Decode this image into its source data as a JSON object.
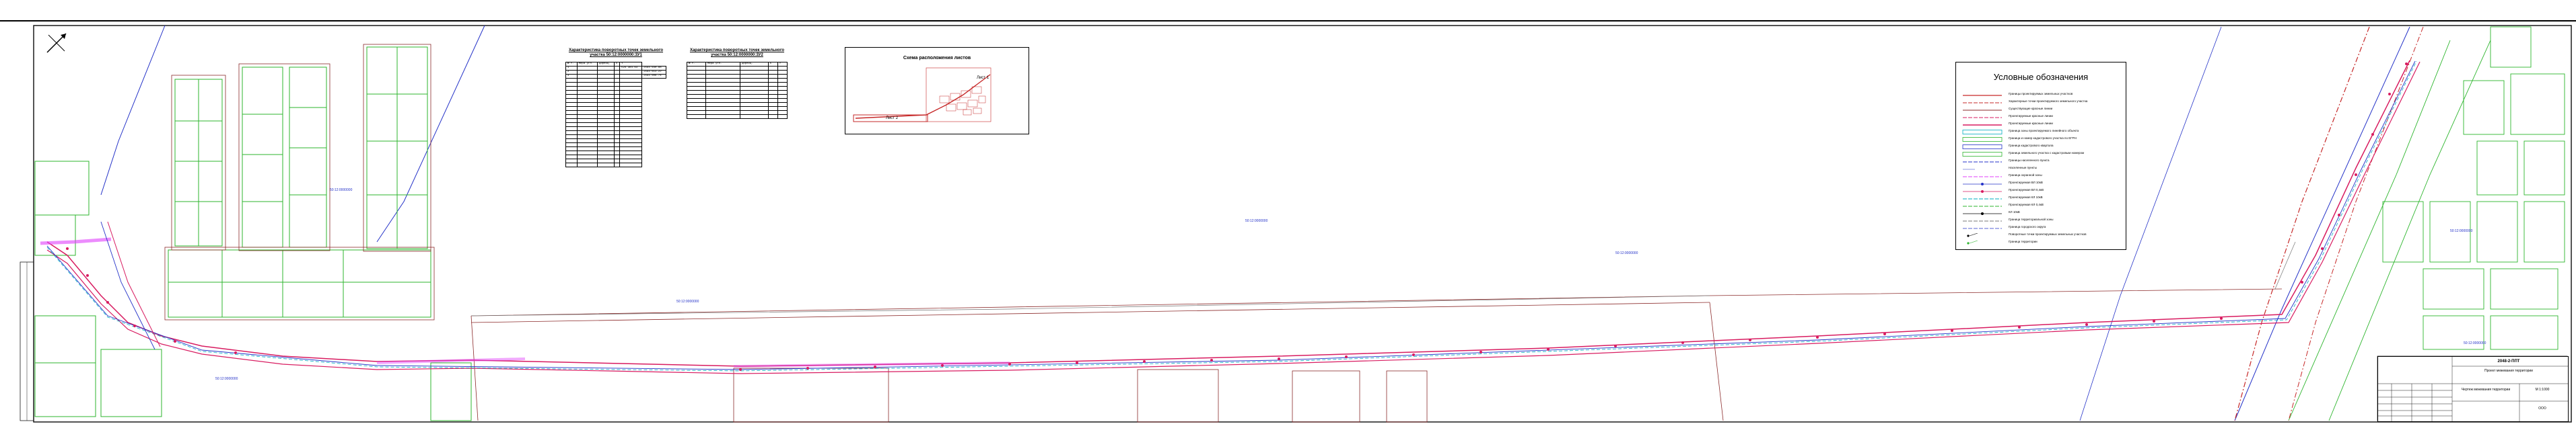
{
  "colors": {
    "border": "#1a1a1a",
    "parcel": "#2db52d",
    "plan_red": "#d81b60",
    "road_red": "#c62828",
    "blue": "#2432c8",
    "pink": "#e040fb",
    "cyan": "#00acc1",
    "gray": "#777777"
  },
  "icons": {
    "north": "north-arrow-icon"
  },
  "table1": {
    "title": "Характеристика поворотных точек земельного участка 50:12:0000000:ЗУ1",
    "rows": [
      [
        "№ т.",
        "Мера угл.",
        "Дирекц.",
        "X",
        "Y"
      ],
      [
        "1",
        "",
        "",
        "",
        "524 384.63",
        "2193 640.88"
      ],
      [
        "2",
        "",
        "",
        "",
        "",
        "2193 613.22"
      ],
      [
        "3",
        "",
        "",
        "",
        "",
        "2193 608.74"
      ]
    ]
  },
  "table2": {
    "title": "Характеристика поворотных точек земельного участка 50:12:0000000:ЗУ2",
    "rows": [
      [
        "№ т.",
        "Мера угл.",
        "Дирекц.",
        "X",
        "Y"
      ]
    ]
  },
  "schema": {
    "title": "Схема расположения листов",
    "sheet1": "Лист 1",
    "sheet2": "Лист 2"
  },
  "legend": {
    "title": "Условные обозначения",
    "items": [
      "Границы проектируемых земельных участков",
      "Характерные точки проектируемого земельного участка",
      "Существующие красные линии",
      "Проектируемые красные линии",
      "Проектируемые красные линии",
      "Граница зоны проектируемого линейного объекта",
      "Граница и номер кадастрового участка по ЕГРН",
      "Граница кадастрового квартала",
      "Граница земельного участка с кадастровым номером",
      "Границы населенного пункта",
      "Населенные пункты",
      "Граница охранной зоны",
      "Проектируемая ВЛ 10кВ",
      "Проектируемая ВЛ 0,4кВ",
      "Проектируемая КЛ 10кВ",
      "Проектируемая КЛ 0,4кВ",
      "КЛ 10кВ",
      "Граница территориальной зоны",
      "Граница городского округа",
      "Поворотные точки проектируемых земельных участков",
      "Граница территории"
    ]
  },
  "stamp": {
    "code": "2048-2-ППТ",
    "title_line1": "Проект межевания территории",
    "sheet_title": "Чертеж межевания территории",
    "scale": "М 1:1000",
    "org": "ООО"
  }
}
